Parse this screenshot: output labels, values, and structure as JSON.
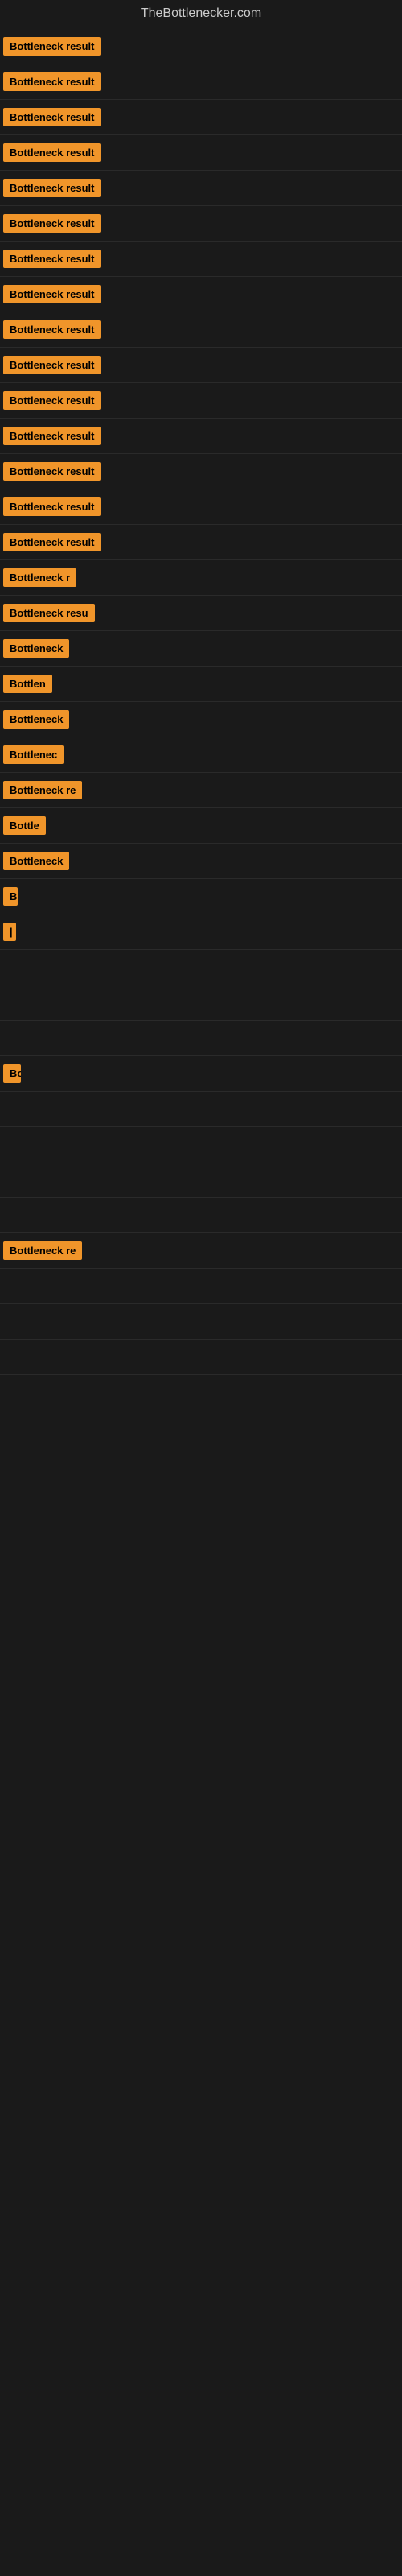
{
  "site": {
    "title": "TheBottlenecker.com"
  },
  "rows": [
    {
      "label": "Bottleneck result",
      "width": 160
    },
    {
      "label": "Bottleneck result",
      "width": 160
    },
    {
      "label": "Bottleneck result",
      "width": 160
    },
    {
      "label": "Bottleneck result",
      "width": 160
    },
    {
      "label": "Bottleneck result",
      "width": 160
    },
    {
      "label": "Bottleneck result",
      "width": 160
    },
    {
      "label": "Bottleneck result",
      "width": 160
    },
    {
      "label": "Bottleneck result",
      "width": 160
    },
    {
      "label": "Bottleneck result",
      "width": 160
    },
    {
      "label": "Bottleneck result",
      "width": 160
    },
    {
      "label": "Bottleneck result",
      "width": 155
    },
    {
      "label": "Bottleneck result",
      "width": 150
    },
    {
      "label": "Bottleneck result",
      "width": 148
    },
    {
      "label": "Bottleneck result",
      "width": 145
    },
    {
      "label": "Bottleneck result",
      "width": 140
    },
    {
      "label": "Bottleneck r",
      "width": 100
    },
    {
      "label": "Bottleneck resu",
      "width": 118
    },
    {
      "label": "Bottleneck",
      "width": 88
    },
    {
      "label": "Bottlen",
      "width": 70
    },
    {
      "label": "Bottleneck",
      "width": 88
    },
    {
      "label": "Bottlenec",
      "width": 82
    },
    {
      "label": "Bottleneck re",
      "width": 106
    },
    {
      "label": "Bottle",
      "width": 58
    },
    {
      "label": "Bottleneck",
      "width": 88
    },
    {
      "label": "B",
      "width": 18
    },
    {
      "label": "|",
      "width": 10
    },
    {
      "label": "",
      "width": 0
    },
    {
      "label": "",
      "width": 0
    },
    {
      "label": "",
      "width": 0
    },
    {
      "label": "Bo",
      "width": 22
    },
    {
      "label": "",
      "width": 0
    },
    {
      "label": "",
      "width": 0
    },
    {
      "label": "",
      "width": 0
    },
    {
      "label": "",
      "width": 0
    },
    {
      "label": "Bottleneck re",
      "width": 106
    },
    {
      "label": "",
      "width": 0
    },
    {
      "label": "",
      "width": 0
    },
    {
      "label": "",
      "width": 0
    }
  ]
}
